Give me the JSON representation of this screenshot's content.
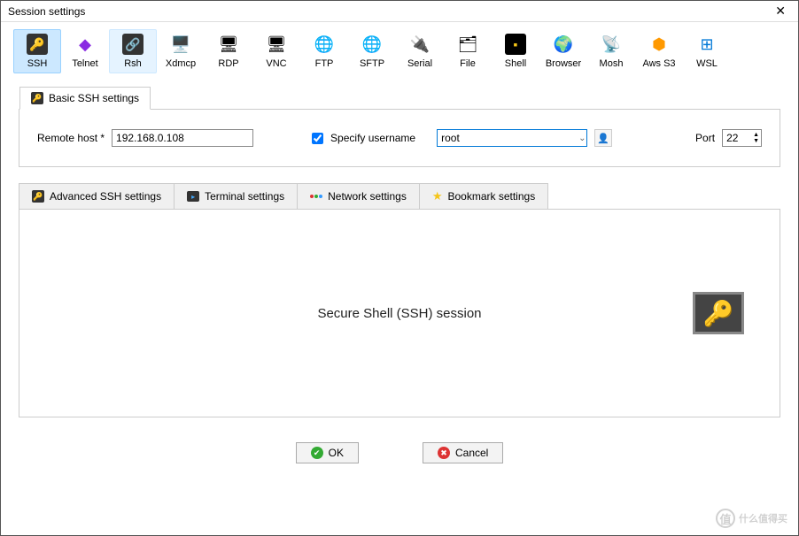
{
  "window": {
    "title": "Session settings"
  },
  "toolbar": [
    {
      "id": "ssh",
      "label": "SSH",
      "icon": "🔑",
      "bg": "#333",
      "selected": true
    },
    {
      "id": "telnet",
      "label": "Telnet",
      "icon": "◆",
      "color": "#8a2be2"
    },
    {
      "id": "rsh",
      "label": "Rsh",
      "icon": "🔗",
      "bg": "#333",
      "hover": true
    },
    {
      "id": "xdmcp",
      "label": "Xdmcp",
      "icon": "🖥️"
    },
    {
      "id": "rdp",
      "label": "RDP",
      "icon": "🖥"
    },
    {
      "id": "vnc",
      "label": "VNC",
      "icon": "🖥"
    },
    {
      "id": "ftp",
      "label": "FTP",
      "icon": "🌐",
      "color": "#2e8b2e"
    },
    {
      "id": "sftp",
      "label": "SFTP",
      "icon": "🌐",
      "color": "#e8a000"
    },
    {
      "id": "serial",
      "label": "Serial",
      "icon": "🔌"
    },
    {
      "id": "file",
      "label": "File",
      "icon": "🗂"
    },
    {
      "id": "shell",
      "label": "Shell",
      "icon": "▪",
      "bg": "#000"
    },
    {
      "id": "browser",
      "label": "Browser",
      "icon": "🌍"
    },
    {
      "id": "mosh",
      "label": "Mosh",
      "icon": "📡"
    },
    {
      "id": "aws",
      "label": "Aws S3",
      "icon": "⬢",
      "color": "#f90"
    },
    {
      "id": "wsl",
      "label": "WSL",
      "icon": "⊞",
      "color": "#0078d7"
    }
  ],
  "basic_tab": {
    "label": "Basic SSH settings"
  },
  "form": {
    "remote_host_label": "Remote host *",
    "remote_host_value": "192.168.0.108",
    "specify_username_label": "Specify username",
    "specify_username_checked": true,
    "username_value": "root",
    "port_label": "Port",
    "port_value": "22"
  },
  "tabs": [
    {
      "id": "adv",
      "label": "Advanced SSH settings",
      "icon": "key"
    },
    {
      "id": "term",
      "label": "Terminal settings",
      "icon": "term"
    },
    {
      "id": "net",
      "label": "Network settings",
      "icon": "net"
    },
    {
      "id": "book",
      "label": "Bookmark settings",
      "icon": "star"
    }
  ],
  "content": {
    "title": "Secure Shell (SSH) session"
  },
  "buttons": {
    "ok": "OK",
    "cancel": "Cancel"
  },
  "watermark": {
    "text": "什么值得买"
  }
}
